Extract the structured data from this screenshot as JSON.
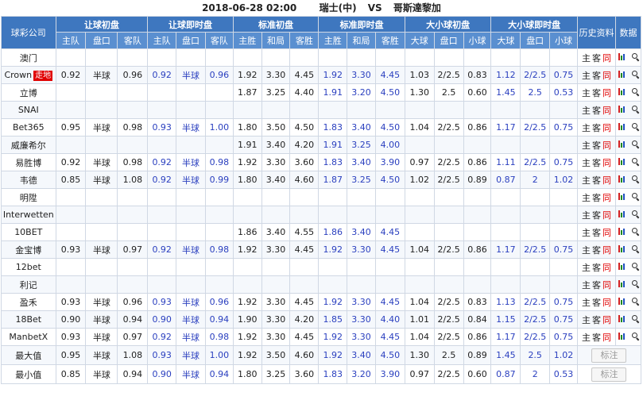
{
  "header": {
    "datetime": "2018-06-28 02:00",
    "home": "瑞士(中)",
    "vs": "VS",
    "away": "哥斯達黎加"
  },
  "columns": {
    "company": "球彩公司",
    "groups": [
      "让球初盘",
      "让球即时盘",
      "标准初盘",
      "标准即时盘",
      "大小球初盘",
      "大小球即时盘"
    ],
    "history": "历史资料",
    "data": "数据",
    "handicap_sub": [
      "主队",
      "盘口",
      "客队"
    ],
    "euro_sub": [
      "主胜",
      "和局",
      "客胜"
    ],
    "ou_sub": [
      "大球",
      "盘口",
      "小球"
    ]
  },
  "history_links": [
    "主",
    "客",
    "同"
  ],
  "flag_label": "走地",
  "note_label": "标注",
  "rows": [
    {
      "company": "澳门",
      "flag": false,
      "c": [
        "",
        "",
        "",
        "",
        "",
        "",
        "",
        "",
        "",
        "",
        "",
        "",
        "",
        "",
        "",
        "",
        "",
        ""
      ]
    },
    {
      "company": "Crown",
      "flag": true,
      "c": [
        "0.92",
        "半球",
        "0.96",
        "0.92",
        "半球",
        "0.96",
        "1.92",
        "3.30",
        "4.45",
        "1.92",
        "3.30",
        "4.45",
        "1.03",
        "2/2.5",
        "0.83",
        "1.12",
        "2/2.5",
        "0.75"
      ]
    },
    {
      "company": "立博",
      "flag": false,
      "c": [
        "",
        "",
        "",
        "",
        "",
        "",
        "1.87",
        "3.25",
        "4.40",
        "1.91",
        "3.20",
        "4.50",
        "1.30",
        "2.5",
        "0.60",
        "1.45",
        "2.5",
        "0.53"
      ]
    },
    {
      "company": "SNAI",
      "flag": false,
      "c": [
        "",
        "",
        "",
        "",
        "",
        "",
        "",
        "",
        "",
        "",
        "",
        "",
        "",
        "",
        "",
        "",
        "",
        ""
      ]
    },
    {
      "company": "Bet365",
      "flag": false,
      "c": [
        "0.95",
        "半球",
        "0.98",
        "0.93",
        "半球",
        "1.00",
        "1.80",
        "3.50",
        "4.50",
        "1.83",
        "3.40",
        "4.50",
        "1.04",
        "2/2.5",
        "0.86",
        "1.17",
        "2/2.5",
        "0.75"
      ]
    },
    {
      "company": "威廉希尔",
      "flag": false,
      "c": [
        "",
        "",
        "",
        "",
        "",
        "",
        "1.91",
        "3.40",
        "4.20",
        "1.91",
        "3.25",
        "4.00",
        "",
        "",
        "",
        "",
        "",
        ""
      ]
    },
    {
      "company": "易胜博",
      "flag": false,
      "c": [
        "0.92",
        "半球",
        "0.98",
        "0.92",
        "半球",
        "0.98",
        "1.92",
        "3.30",
        "3.60",
        "1.83",
        "3.40",
        "3.90",
        "0.97",
        "2/2.5",
        "0.86",
        "1.11",
        "2/2.5",
        "0.75"
      ]
    },
    {
      "company": "韦德",
      "flag": false,
      "c": [
        "0.85",
        "半球",
        "1.08",
        "0.92",
        "半球",
        "0.99",
        "1.80",
        "3.40",
        "4.60",
        "1.87",
        "3.25",
        "4.50",
        "1.02",
        "2/2.5",
        "0.89",
        "0.87",
        "2",
        "1.02"
      ]
    },
    {
      "company": "明陞",
      "flag": false,
      "c": [
        "",
        "",
        "",
        "",
        "",
        "",
        "",
        "",
        "",
        "",
        "",
        "",
        "",
        "",
        "",
        "",
        "",
        ""
      ]
    },
    {
      "company": "Interwetten",
      "flag": false,
      "c": [
        "",
        "",
        "",
        "",
        "",
        "",
        "",
        "",
        "",
        "",
        "",
        "",
        "",
        "",
        "",
        "",
        "",
        ""
      ]
    },
    {
      "company": "10BET",
      "flag": false,
      "c": [
        "",
        "",
        "",
        "",
        "",
        "",
        "1.86",
        "3.40",
        "4.55",
        "1.86",
        "3.40",
        "4.45",
        "",
        "",
        "",
        "",
        "",
        ""
      ]
    },
    {
      "company": "金宝博",
      "flag": false,
      "c": [
        "0.93",
        "半球",
        "0.97",
        "0.92",
        "半球",
        "0.98",
        "1.92",
        "3.30",
        "4.45",
        "1.92",
        "3.30",
        "4.45",
        "1.04",
        "2/2.5",
        "0.86",
        "1.17",
        "2/2.5",
        "0.75"
      ]
    },
    {
      "company": "12bet",
      "flag": false,
      "c": [
        "",
        "",
        "",
        "",
        "",
        "",
        "",
        "",
        "",
        "",
        "",
        "",
        "",
        "",
        "",
        "",
        "",
        ""
      ]
    },
    {
      "company": "利记",
      "flag": false,
      "c": [
        "",
        "",
        "",
        "",
        "",
        "",
        "",
        "",
        "",
        "",
        "",
        "",
        "",
        "",
        "",
        "",
        "",
        ""
      ]
    },
    {
      "company": "盈禾",
      "flag": false,
      "c": [
        "0.93",
        "半球",
        "0.96",
        "0.93",
        "半球",
        "0.96",
        "1.92",
        "3.30",
        "4.45",
        "1.92",
        "3.30",
        "4.45",
        "1.04",
        "2/2.5",
        "0.83",
        "1.13",
        "2/2.5",
        "0.75"
      ]
    },
    {
      "company": "18Bet",
      "flag": false,
      "c": [
        "0.90",
        "半球",
        "0.94",
        "0.90",
        "半球",
        "0.94",
        "1.90",
        "3.30",
        "4.20",
        "1.85",
        "3.30",
        "4.40",
        "1.01",
        "2/2.5",
        "0.84",
        "1.15",
        "2/2.5",
        "0.75"
      ]
    },
    {
      "company": "ManbetX",
      "flag": false,
      "c": [
        "0.93",
        "半球",
        "0.97",
        "0.92",
        "半球",
        "0.98",
        "1.92",
        "3.30",
        "4.45",
        "1.92",
        "3.30",
        "4.45",
        "1.04",
        "2/2.5",
        "0.86",
        "1.17",
        "2/2.5",
        "0.75"
      ]
    }
  ],
  "stats": [
    {
      "label": "最大值",
      "c": [
        "0.95",
        "半球",
        "1.08",
        "0.93",
        "半球",
        "1.00",
        "1.92",
        "3.50",
        "4.60",
        "1.92",
        "3.40",
        "4.50",
        "1.30",
        "2.5",
        "0.89",
        "1.45",
        "2.5",
        "1.02"
      ]
    },
    {
      "label": "最小值",
      "c": [
        "0.85",
        "半球",
        "0.94",
        "0.90",
        "半球",
        "0.94",
        "1.80",
        "3.25",
        "3.60",
        "1.83",
        "3.20",
        "3.90",
        "0.97",
        "2/2.5",
        "0.60",
        "0.87",
        "2",
        "0.53"
      ]
    }
  ]
}
